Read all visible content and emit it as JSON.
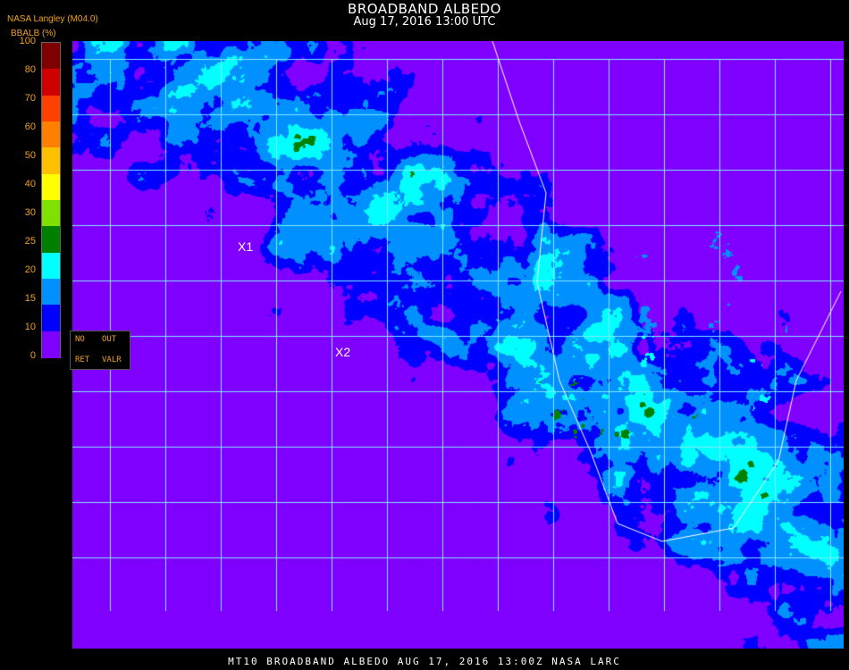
{
  "header": {
    "title": "BROADBAND ALBEDO",
    "datetime": "Aug 17, 2016 13:00 UTC",
    "source": "NASA Langley (M04.0)"
  },
  "legend": {
    "name": "BBALB (%)",
    "ticks": [
      "100",
      "80",
      "70",
      "60",
      "50",
      "40",
      "30",
      "25",
      "20",
      "15",
      "10",
      "0"
    ],
    "colors": [
      "#7f0000",
      "#d00000",
      "#ff4000",
      "#ff8000",
      "#ffc000",
      "#ffff00",
      "#80e000",
      "#008000",
      "#00ffff",
      "#0090ff",
      "#0000ff",
      "#8000ff"
    ]
  },
  "no_data_box": {
    "no": "NO",
    "out": "OUT",
    "ret": "RET",
    "valr": "VALR"
  },
  "markers": {
    "x1": "X1",
    "x2": "X2"
  },
  "footer": "MT10  BROADBAND ALBEDO   AUG 17, 2016 13:00Z   NASA LARC"
}
